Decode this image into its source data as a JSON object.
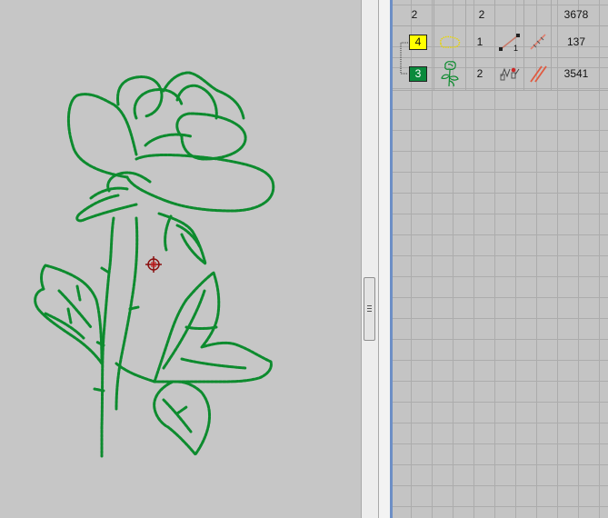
{
  "sequence_panel": {
    "header": {
      "col_a": "2",
      "col_b": "2",
      "stitches": "3678"
    },
    "rows": [
      {
        "color_number": "4",
        "color_hex": "#ffff00",
        "thumbnail_icon": "yellow-outline-thumbnail-icon",
        "count": "1",
        "stitch_type_icon": "running-stitch-icon",
        "connector_icon": "jump-stitch-icon",
        "stitches": "137"
      },
      {
        "color_number": "3",
        "color_hex": "#0a8a3c",
        "thumbnail_icon": "rose-thumbnail-icon",
        "count": "2",
        "stitch_type_icon": "triple-stitch-icon",
        "connector_icon": "trim-icon",
        "stitches": "3541"
      }
    ]
  },
  "design_canvas": {
    "stitch_color": "#0c8b2e",
    "cursor_icon": "needle-position-icon"
  }
}
